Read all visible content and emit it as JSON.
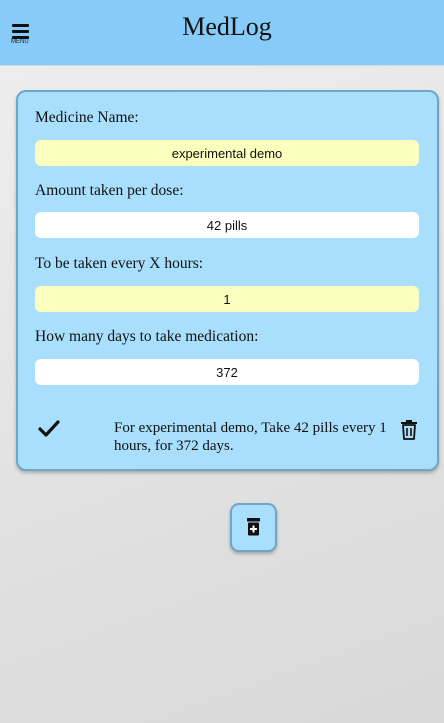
{
  "header": {
    "menu_label": "MENU",
    "title": "MedLog",
    "background_color": "#87cbf9"
  },
  "form": {
    "medicine_name_label": "Medicine Name:",
    "medicine_name_value": "experimental demo",
    "amount_label": "Amount taken per dose:",
    "amount_value": "42 pills",
    "interval_label": "To be taken every X hours:",
    "interval_value": "1",
    "days_label": "How many days to take medication:",
    "days_value": "372",
    "card_color": "#a8dffd",
    "highlight_color": "#fbffbd"
  },
  "entry": {
    "confirm_icon": "checkmark-icon",
    "summary": "For experimental demo, Take 42 pills every 1 hours, for 372 days.",
    "delete_icon": "trash-icon"
  },
  "actions": {
    "add_medication_icon": "medicine-bottle-add-icon"
  }
}
